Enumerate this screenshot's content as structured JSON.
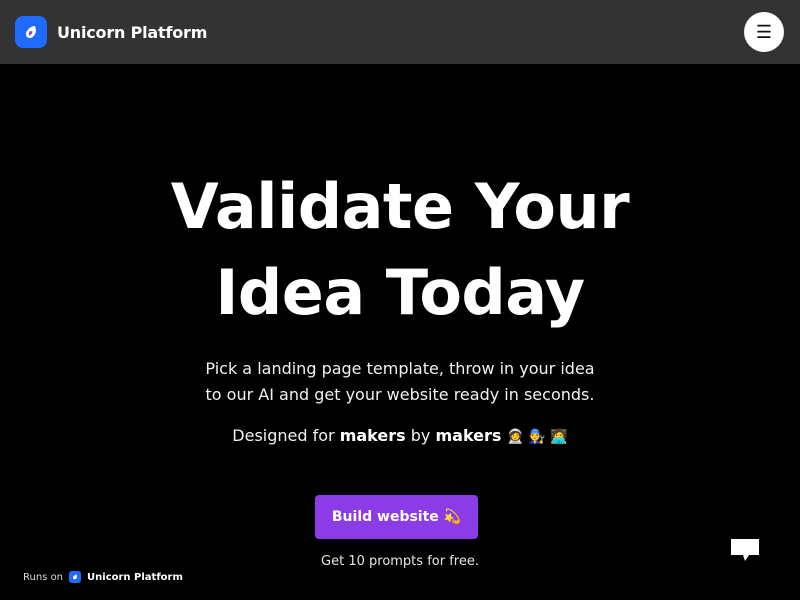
{
  "header": {
    "brand_name": "Unicorn Platform",
    "logo_icon": "unicorn-logo-icon",
    "menu_icon": "hamburger-menu-icon",
    "menu_glyph": "☰"
  },
  "hero": {
    "headline_line1": "Validate Your",
    "headline_line2": "Idea Today",
    "subtitle_line1": "Pick a landing page template, throw in your idea",
    "subtitle_line2": "to our AI and get your website ready in seconds.",
    "designed_prefix": "Designed for",
    "designed_makers1": "makers",
    "designed_by": "by",
    "designed_makers2": "makers",
    "designed_emoji": "🧑‍🚀 🧑‍🔧 🧑‍💻",
    "cta_label": "Build website 💫",
    "cta_note": "Get 10 prompts for free."
  },
  "footer": {
    "runs_on_label": "Runs on",
    "runs_on_brand": "Unicorn Platform"
  },
  "chat": {
    "icon": "chat-bubble-icon"
  },
  "colors": {
    "background": "#000000",
    "header": "#333333",
    "brand_blue": "#1f6bff",
    "cta_purple": "#8c3ce6"
  }
}
